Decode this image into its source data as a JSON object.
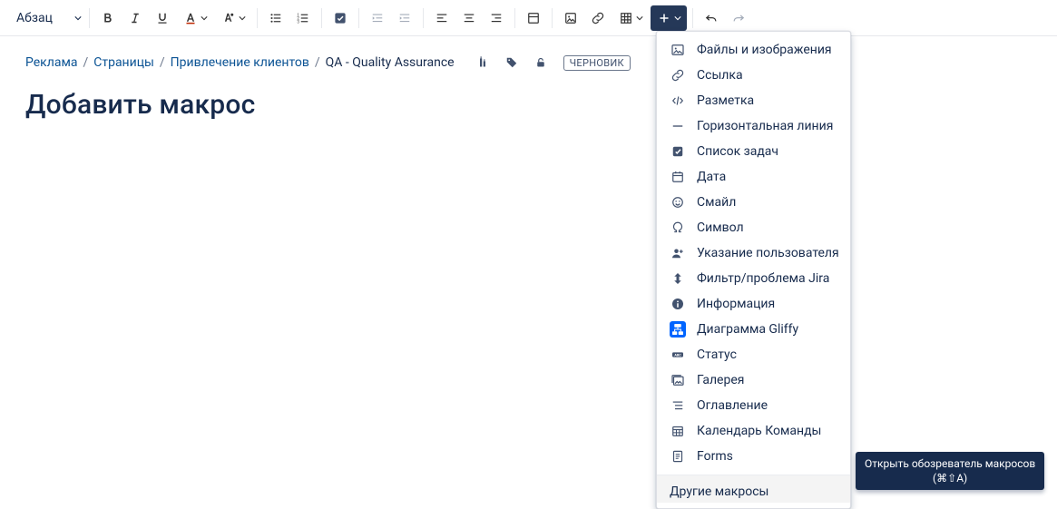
{
  "toolbar": {
    "heading_select": "Абзац"
  },
  "breadcrumbs": {
    "items": [
      "Реклама",
      "Страницы",
      "Привлечение клиентов",
      "QA - Quality Assurance"
    ]
  },
  "status_badge": "ЧЕРНОВИК",
  "page_title": "Добавить макрос",
  "insert_menu": {
    "items": [
      {
        "label": "Файлы и изображения"
      },
      {
        "label": "Ссылка"
      },
      {
        "label": "Разметка"
      },
      {
        "label": "Горизонтальная линия"
      },
      {
        "label": "Список задач"
      },
      {
        "label": "Дата"
      },
      {
        "label": "Смайл"
      },
      {
        "label": "Символ"
      },
      {
        "label": "Указание пользователя"
      },
      {
        "label": "Фильтр/проблема Jira"
      },
      {
        "label": "Информация"
      },
      {
        "label": "Диаграмма Gliffy"
      },
      {
        "label": "Статус"
      },
      {
        "label": "Галерея"
      },
      {
        "label": "Оглавление"
      },
      {
        "label": "Календарь Команды"
      },
      {
        "label": "Forms"
      }
    ],
    "footer": "Другие макросы"
  },
  "tooltip": {
    "line1": "Открыть обозреватель макросов",
    "line2": "(⌘⇧A)"
  }
}
